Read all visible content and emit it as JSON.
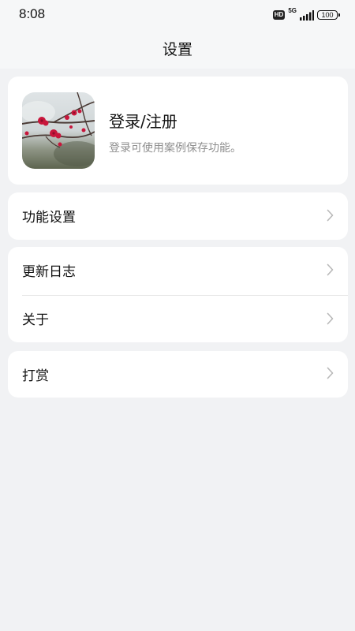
{
  "status_bar": {
    "time": "8:08",
    "hd": "HD",
    "network": "5G",
    "battery": "100",
    "icons": [
      "hd-icon",
      "signal-icon",
      "battery-icon"
    ]
  },
  "header": {
    "title": "设置"
  },
  "profile": {
    "title": "登录/注册",
    "subtitle": "登录可使用案例保存功能。"
  },
  "groups": [
    {
      "items": [
        {
          "label": "功能设置"
        }
      ]
    },
    {
      "items": [
        {
          "label": "更新日志"
        },
        {
          "label": "关于"
        }
      ]
    },
    {
      "items": [
        {
          "label": "打赏"
        }
      ]
    }
  ],
  "colors": {
    "background": "#f1f2f4",
    "card": "#ffffff",
    "subtitle": "#8f8f8f",
    "chevron": "#b8b8b8"
  }
}
